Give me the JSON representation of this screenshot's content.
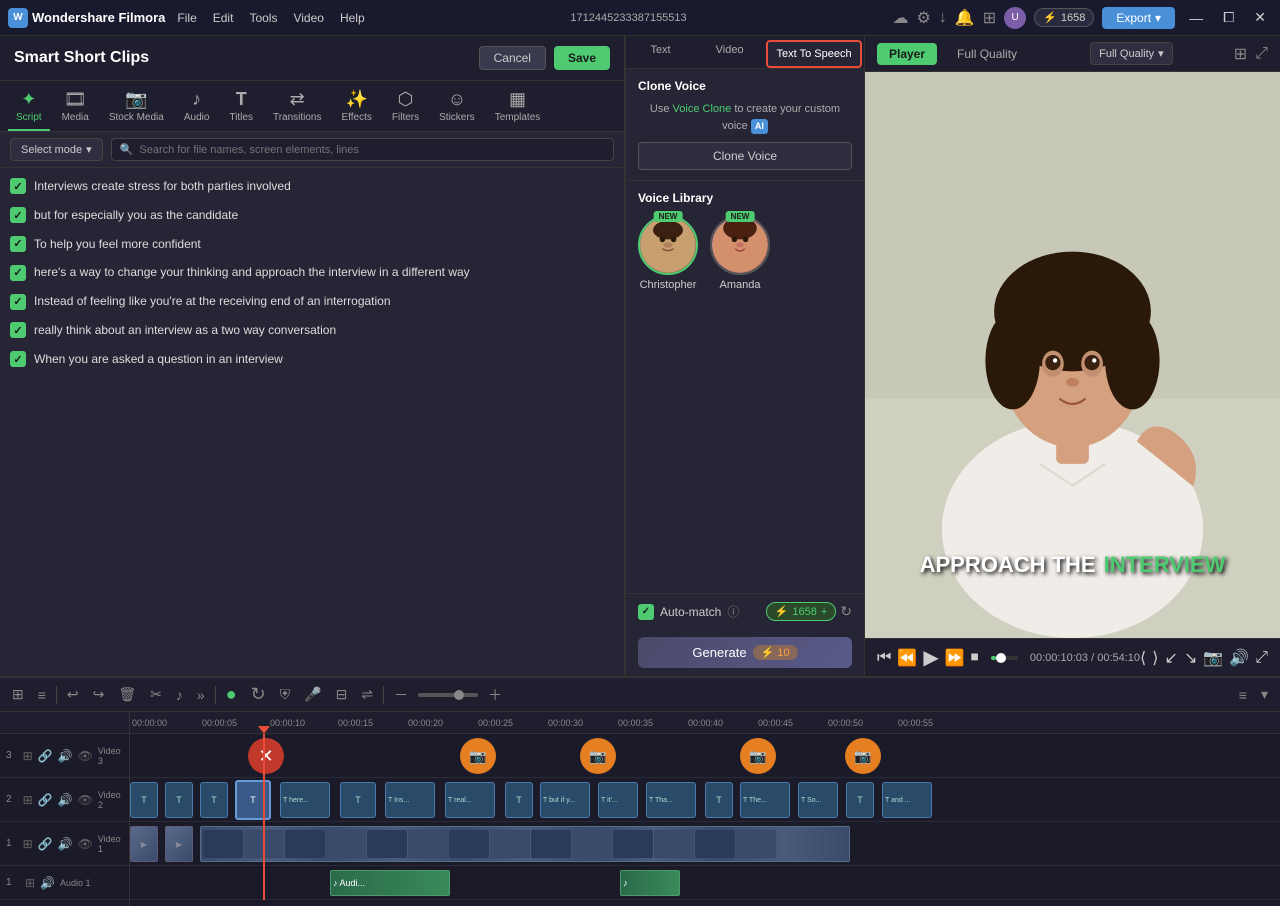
{
  "app": {
    "name": "Wondershare Filmora",
    "logo_letter": "W",
    "page_title": "1712445233387155513"
  },
  "topbar": {
    "menu": [
      "File",
      "Edit",
      "Tools",
      "Video",
      "Help"
    ],
    "export_label": "Export",
    "credits": "1658",
    "win_btns": [
      "—",
      "⧠",
      "✕"
    ]
  },
  "header": {
    "title": "Smart Short Clips",
    "cancel_label": "Cancel",
    "save_label": "Save"
  },
  "tool_tabs": [
    {
      "id": "script",
      "icon": "✦",
      "label": "Script",
      "active": true
    },
    {
      "id": "media",
      "icon": "🎞",
      "label": "Media"
    },
    {
      "id": "stock-media",
      "icon": "📷",
      "label": "Stock Media"
    },
    {
      "id": "audio",
      "icon": "🎵",
      "label": "Audio"
    },
    {
      "id": "titles",
      "icon": "T",
      "label": "Titles"
    },
    {
      "id": "transitions",
      "icon": "⇄",
      "label": "Transitions"
    },
    {
      "id": "effects",
      "icon": "✨",
      "label": "Effects"
    },
    {
      "id": "filters",
      "icon": "⬡",
      "label": "Filters"
    },
    {
      "id": "stickers",
      "icon": "☺",
      "label": "Stickers"
    },
    {
      "id": "templates",
      "icon": "▦",
      "label": "Templates"
    }
  ],
  "toolbar": {
    "select_mode_label": "Select mode",
    "search_placeholder": "Search for file names, screen elements, lines"
  },
  "script_items": [
    {
      "text": "Interviews create stress for both parties involved",
      "checked": true
    },
    {
      "text": "but for especially you as the candidate",
      "checked": true
    },
    {
      "text": "To help you feel more confident",
      "checked": true
    },
    {
      "text": "here's a way to change your thinking and approach the interview in a different way",
      "checked": true
    },
    {
      "text": "Instead of feeling like you're at the receiving end of an interrogation",
      "checked": true
    },
    {
      "text": "really think about an interview as a two way conversation",
      "checked": true
    },
    {
      "text": "When you are asked a question in an interview",
      "checked": true
    }
  ],
  "voice_tabs": [
    {
      "label": "Text",
      "id": "text"
    },
    {
      "label": "Video",
      "id": "video"
    },
    {
      "label": "Text To Speech",
      "id": "tts",
      "active": true
    }
  ],
  "clone_voice": {
    "title": "Clone Voice",
    "desc_part1": "Use ",
    "link": "Voice Clone",
    "desc_part2": " to create your custom voice",
    "ai_badge": "AI",
    "btn_label": "Clone Voice"
  },
  "voice_library": {
    "title": "Voice Library",
    "voices": [
      {
        "name": "Christopher",
        "badge": "NEW",
        "type": "male"
      },
      {
        "name": "Amanda",
        "badge": "NEW",
        "type": "female"
      }
    ]
  },
  "auto_match": {
    "label": "Auto-match",
    "credits_value": "1658",
    "credits_plus": "+",
    "refresh_icon": "↻"
  },
  "generate_btn": {
    "label": "Generate",
    "icon": "⚡",
    "credits": "10"
  },
  "preview": {
    "tabs": [
      {
        "label": "Player",
        "active": true
      },
      {
        "label": "Full Quality"
      }
    ],
    "current_time": "00:00:10:03",
    "total_time": "00:54:10",
    "overlay_words": [
      "APPROACH THE",
      "INTERVIEW"
    ],
    "overlay_highlight_index": 1
  },
  "timeline": {
    "tracks": [
      {
        "num": "3",
        "label": "Video 3"
      },
      {
        "num": "2",
        "label": "Video 2"
      },
      {
        "num": "1",
        "label": "Video 1"
      },
      {
        "num": "1",
        "label": "Audio 1"
      }
    ],
    "time_markers": [
      "00:00:00",
      "00:00:05",
      "00:00:10",
      "00:00:15",
      "00:00:20",
      "00:00:25",
      "00:00:30",
      "00:00:35",
      "00:00:40",
      "00:00:45",
      "00:00:50",
      "00:00:55"
    ],
    "text_clip": "and _"
  }
}
